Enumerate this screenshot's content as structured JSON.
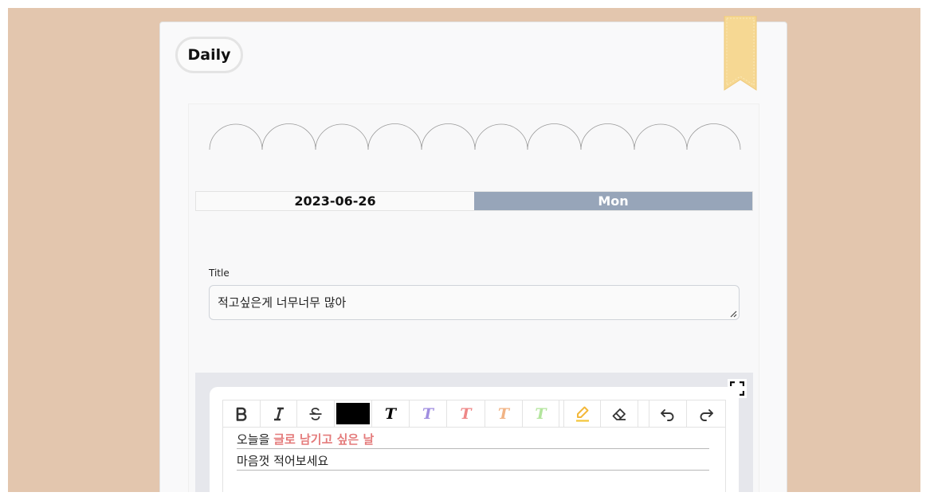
{
  "header": {
    "daily_label": "Daily"
  },
  "date": {
    "value": "2023-06-26",
    "day": "Mon"
  },
  "title_field": {
    "label": "Title",
    "value": "적고싶은게 너무너무 많아"
  },
  "editor": {
    "toolbar": [
      {
        "name": "bold-button",
        "glyph": "B"
      },
      {
        "name": "italic-button",
        "glyph": "I"
      },
      {
        "name": "strikethrough-button",
        "glyph": "S"
      },
      {
        "name": "text-color-swatch",
        "color": "#000000"
      },
      {
        "name": "text-black-button",
        "glyph": "T",
        "color": "#000000"
      },
      {
        "name": "text-purple-button",
        "glyph": "T",
        "color": "#a08ee0"
      },
      {
        "name": "text-red-button",
        "glyph": "T",
        "color": "#ee8787"
      },
      {
        "name": "text-orange-button",
        "glyph": "T",
        "color": "#f1b384"
      },
      {
        "name": "text-green-button",
        "glyph": "T",
        "color": "#b3e59d"
      },
      {
        "name": "highlight-button",
        "color": "#f3c53a"
      },
      {
        "name": "eraser-button"
      },
      {
        "name": "undo-button"
      },
      {
        "name": "redo-button"
      }
    ],
    "line1_prefix": "오늘을",
    "line1_highlight": "글로 남기고 싶은 날",
    "line2": "마음껏 적어보세요"
  },
  "colors": {
    "background": "#e3c6ae",
    "day_cell": "#97a5b9",
    "bookmark": "#f6d893",
    "highlight_text": "#e47b7b"
  }
}
